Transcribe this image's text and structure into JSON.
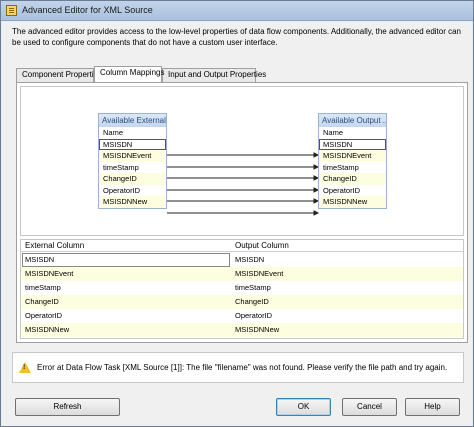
{
  "window": {
    "title": "Advanced Editor for XML Source"
  },
  "description": "The advanced editor provides access to the low-level properties of data flow components. Additionally, the advanced editor can be used to configure components that do not have a custom user interface.",
  "tabs": [
    {
      "label": "Component Properties"
    },
    {
      "label": "Column Mappings"
    },
    {
      "label": "Input and Output Properties"
    }
  ],
  "diagram": {
    "left_box_title": "Available External ...",
    "right_box_title": "Available Output ...",
    "header": "Name",
    "columns": [
      "MSISDN",
      "MSISDNEvent",
      "timeStamp",
      "ChangeID",
      "OperatorID",
      "MSISDNNew"
    ]
  },
  "grid": {
    "headers": [
      "External Column",
      "Output Column"
    ],
    "rows": [
      [
        "MSISDN",
        "MSISDN"
      ],
      [
        "MSISDNEvent",
        "MSISDNEvent"
      ],
      [
        "timeStamp",
        "timeStamp"
      ],
      [
        "ChangeID",
        "ChangeID"
      ],
      [
        "OperatorID",
        "OperatorID"
      ],
      [
        "MSISDNNew",
        "MSISDNNew"
      ]
    ]
  },
  "message": "Error at Data Flow Task [XML Source [1]]: The file \"filename\" was not found. Please verify the file path and try again.",
  "buttons": {
    "refresh": "Refresh",
    "ok": "OK",
    "cancel": "Cancel",
    "help": "Help"
  },
  "colors": {
    "accent": "#3c7fb1",
    "row_highlight": "#fdfde0",
    "warning": "#f0c020"
  },
  "icons": {
    "app": "xml-source-icon",
    "warning": "warning-icon"
  }
}
